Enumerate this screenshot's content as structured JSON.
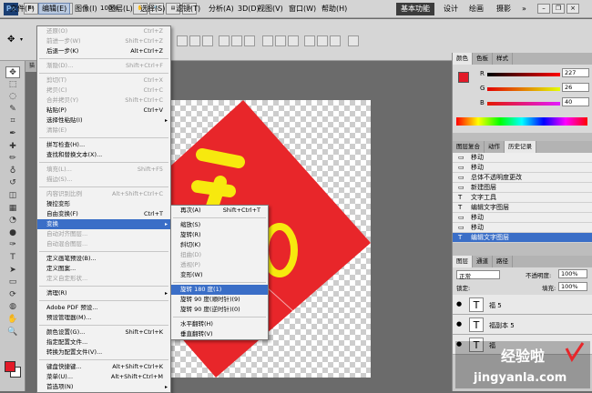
{
  "app": {
    "logo": "Ps",
    "zoom": "100%"
  },
  "menubar": {
    "items": [
      "文件(F)",
      "编辑(E)",
      "图像(I)",
      "图层(L)",
      "选择(S)",
      "滤镜(T)",
      "分析(A)",
      "3D(D)",
      "视图(V)",
      "窗口(W)",
      "帮助(H)"
    ],
    "workspaces": [
      "基本功能",
      "设计",
      "绘画",
      "摄影"
    ],
    "more": "»"
  },
  "document": {
    "tab": "猫"
  },
  "edit_menu": [
    {
      "label": "还原(O)",
      "shortcut": "Ctrl+Z",
      "disabled": true
    },
    {
      "label": "前进一步(W)",
      "shortcut": "Shift+Ctrl+Z",
      "disabled": true
    },
    {
      "label": "后退一步(K)",
      "shortcut": "Alt+Ctrl+Z"
    },
    {
      "sep": true
    },
    {
      "label": "渐隐(D)...",
      "shortcut": "Shift+Ctrl+F",
      "disabled": true
    },
    {
      "sep": true
    },
    {
      "label": "剪切(T)",
      "shortcut": "Ctrl+X",
      "disabled": true
    },
    {
      "label": "拷贝(C)",
      "shortcut": "Ctrl+C",
      "disabled": true
    },
    {
      "label": "合并拷贝(Y)",
      "shortcut": "Shift+Ctrl+C",
      "disabled": true
    },
    {
      "label": "粘贴(P)",
      "shortcut": "Ctrl+V"
    },
    {
      "label": "选择性粘贴(I)",
      "arrow": true
    },
    {
      "label": "清除(E)",
      "disabled": true
    },
    {
      "sep": true
    },
    {
      "label": "拼写检查(H)..."
    },
    {
      "label": "查找和替换文本(X)..."
    },
    {
      "sep": true
    },
    {
      "label": "填充(L)...",
      "shortcut": "Shift+F5",
      "disabled": true
    },
    {
      "label": "描边(S)...",
      "disabled": true
    },
    {
      "sep": true
    },
    {
      "label": "内容识别比例",
      "shortcut": "Alt+Shift+Ctrl+C",
      "disabled": true
    },
    {
      "label": "操控变形"
    },
    {
      "label": "自由变换(F)",
      "shortcut": "Ctrl+T"
    },
    {
      "label": "变换",
      "arrow": true,
      "highlight": true
    },
    {
      "label": "自动对齐图层...",
      "disabled": true
    },
    {
      "label": "自动混合图层...",
      "disabled": true
    },
    {
      "sep": true
    },
    {
      "label": "定义画笔预设(B)..."
    },
    {
      "label": "定义图案..."
    },
    {
      "label": "定义自定形状...",
      "disabled": true
    },
    {
      "sep": true
    },
    {
      "label": "清理(R)",
      "arrow": true
    },
    {
      "sep": true
    },
    {
      "label": "Adobe PDF 预设..."
    },
    {
      "label": "预设管理器(M)..."
    },
    {
      "sep": true
    },
    {
      "label": "颜色设置(G)...",
      "shortcut": "Shift+Ctrl+K"
    },
    {
      "label": "指定配置文件..."
    },
    {
      "label": "转换为配置文件(V)..."
    },
    {
      "sep": true
    },
    {
      "label": "键盘快捷键...",
      "shortcut": "Alt+Shift+Ctrl+K"
    },
    {
      "label": "菜单(U)...",
      "shortcut": "Alt+Shift+Ctrl+M"
    },
    {
      "label": "首选项(N)",
      "arrow": true
    }
  ],
  "transform_menu": [
    {
      "label": "再次(A)",
      "shortcut": "Shift+Ctrl+T"
    },
    {
      "sep": true
    },
    {
      "label": "缩放(S)"
    },
    {
      "label": "旋转(R)"
    },
    {
      "label": "斜切(K)"
    },
    {
      "label": "扭曲(D)",
      "disabled": true
    },
    {
      "label": "透视(P)",
      "disabled": true
    },
    {
      "label": "变形(W)"
    },
    {
      "sep": true
    },
    {
      "label": "旋转 180 度(1)",
      "highlight": true
    },
    {
      "label": "旋转 90 度(顺时针)(9)"
    },
    {
      "label": "旋转 90 度(逆时针)(0)"
    },
    {
      "sep": true
    },
    {
      "label": "水平翻转(H)"
    },
    {
      "label": "垂直翻转(V)"
    }
  ],
  "color_panel": {
    "tabs": [
      "颜色",
      "色板",
      "样式"
    ],
    "r": "227",
    "g": "26",
    "b": "40",
    "labels": [
      "R",
      "G",
      "B"
    ]
  },
  "history_panel": {
    "tabs": [
      "图层复合",
      "动作",
      "历史记录"
    ],
    "items": [
      "移动",
      "移动",
      "总体不透明度更改",
      "新建图层",
      "文字工具",
      "编辑文字图层",
      "移动",
      "移动",
      "编辑文字图层"
    ]
  },
  "layers_panel": {
    "tabs": [
      "图层",
      "通道",
      "路径"
    ],
    "blend": "正常",
    "opacity_label": "不透明度:",
    "opacity": "100%",
    "lock_label": "锁定:",
    "fill_label": "填充:",
    "fill": "100%",
    "layers": [
      "福 5",
      "福副本 5",
      "福"
    ]
  },
  "watermark": {
    "title": "经验啦",
    "url": "jingyanla.com"
  },
  "colors": {
    "swatch_fg": "#e31a28",
    "canvas_red": "#e8262a",
    "canvas_yellow": "#f7e90e"
  }
}
